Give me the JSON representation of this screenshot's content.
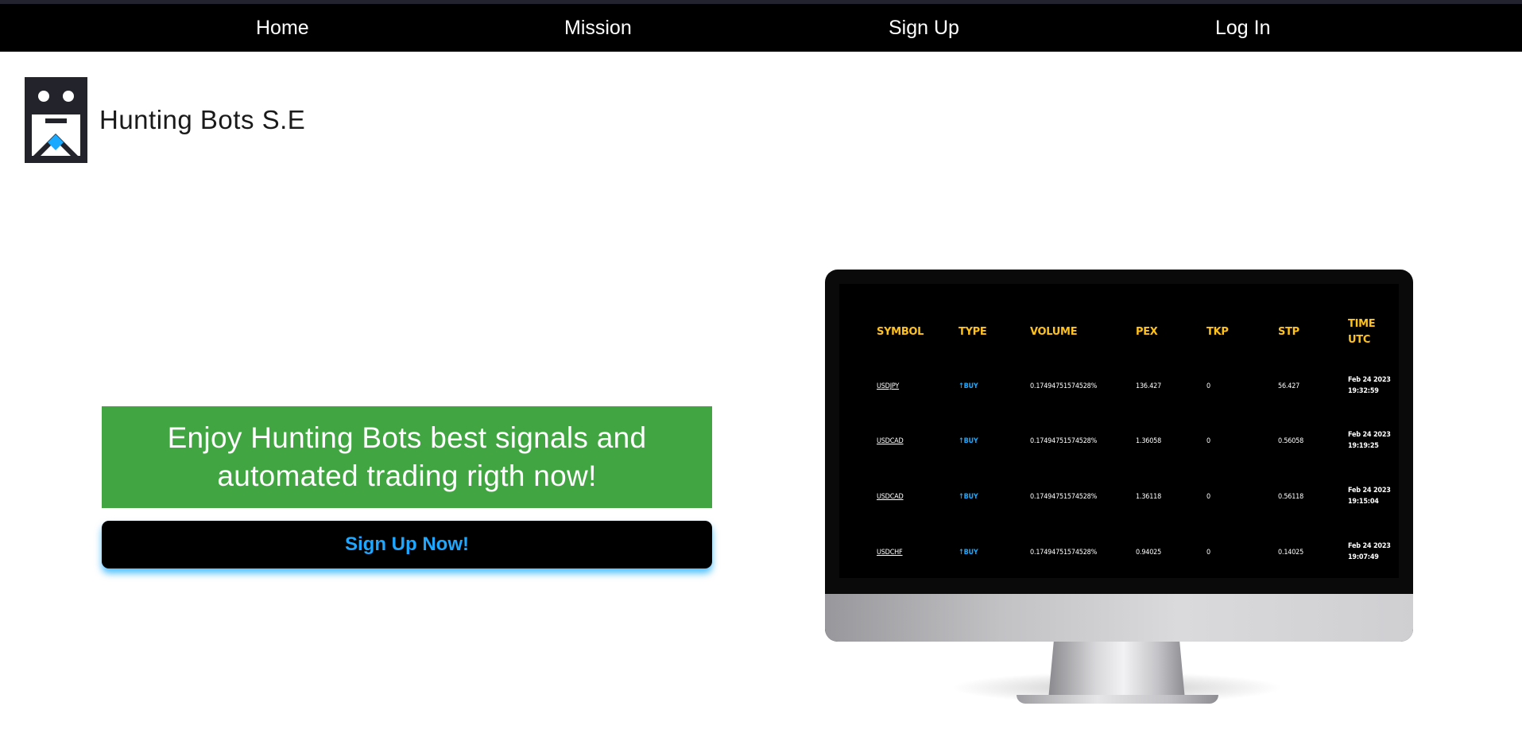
{
  "nav": {
    "items": [
      {
        "label": "Home"
      },
      {
        "label": "Mission"
      },
      {
        "label": "Sign Up"
      },
      {
        "label": "Log In"
      }
    ]
  },
  "brand": {
    "name": "Hunting Bots S.E",
    "logo_icon": "robot-face-logo"
  },
  "hero": {
    "headline_line1": "Enjoy Hunting Bots best signals and",
    "headline_line2": "automated trading rigth now!",
    "cta_label": "Sign Up Now!"
  },
  "colors": {
    "nav_bg": "#000000",
    "promo_green": "#41a642",
    "cta_text": "#1ea7ff",
    "table_header": "#ffc21a",
    "buy_blue": "#19a9ff"
  },
  "signals_table": {
    "headers": [
      "SYMBOL",
      "TYPE",
      "VOLUME",
      "PEX",
      "TKP",
      "STP",
      "TIME",
      "UTC"
    ],
    "rows": [
      {
        "symbol": "USDJPY",
        "type": "↑BUY",
        "volume": "0.17494751574528%",
        "pex": "136.427",
        "tkp": "0",
        "stp": "56.427",
        "date": "Feb 24 2023",
        "time": "19:32:59"
      },
      {
        "symbol": "USDCAD",
        "type": "↑BUY",
        "volume": "0.17494751574528%",
        "pex": "1.36058",
        "tkp": "0",
        "stp": "0.56058",
        "date": "Feb 24 2023",
        "time": "19:19:25"
      },
      {
        "symbol": "USDCAD",
        "type": "↑BUY",
        "volume": "0.17494751574528%",
        "pex": "1.36118",
        "tkp": "0",
        "stp": "0.56118",
        "date": "Feb 24 2023",
        "time": "19:15:04"
      },
      {
        "symbol": "USDCHF",
        "type": "↑BUY",
        "volume": "0.17494751574528%",
        "pex": "0.94025",
        "tkp": "0",
        "stp": "0.14025",
        "date": "Feb 24 2023",
        "time": "19:07:49"
      }
    ]
  }
}
